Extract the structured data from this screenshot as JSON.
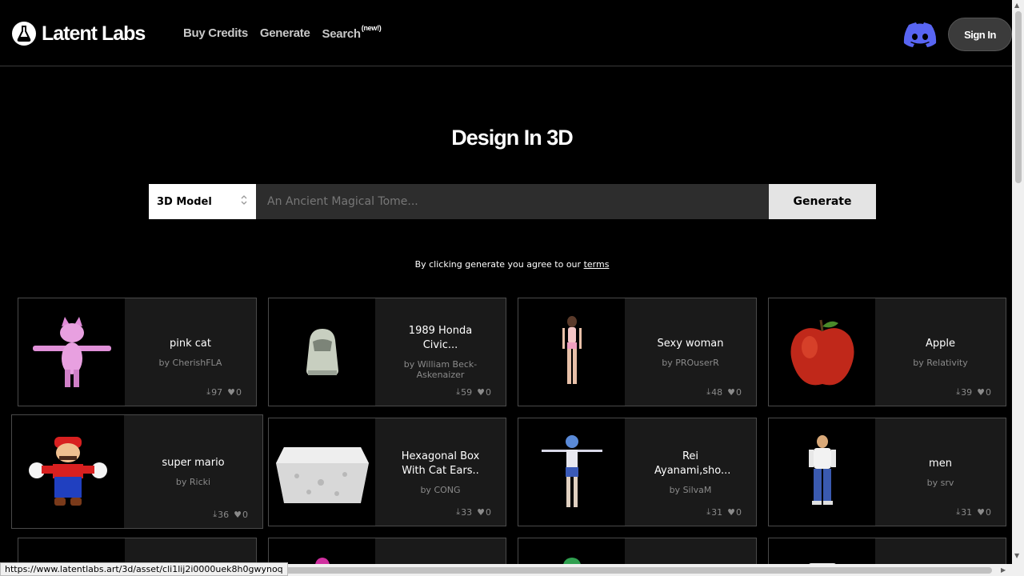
{
  "header": {
    "logo_text": "Latent Labs",
    "nav": [
      {
        "label": "Buy Credits"
      },
      {
        "label": "Generate"
      },
      {
        "label": "Search",
        "badge": "(new!)"
      }
    ],
    "signin_label": "Sign In",
    "discord_icon": "discord-icon",
    "discord_color": "#5865F2"
  },
  "hero": {
    "title": "Design In 3D",
    "select_value": "3D Model",
    "prompt_placeholder": "An Ancient Magical Tome...",
    "generate_label": "Generate",
    "terms_text": "By clicking generate you agree to our ",
    "terms_link": "terms"
  },
  "cards": [
    {
      "name": "pink cat",
      "author": "by CherishFLA",
      "downloads": "97",
      "likes": "0",
      "thumb": "pink-cat"
    },
    {
      "name": "1989 Honda Civic...",
      "author": "by William Beck-Askenaizer",
      "downloads": "59",
      "likes": "0",
      "thumb": "car"
    },
    {
      "name": "Sexy woman",
      "author": "by PROuserR",
      "downloads": "48",
      "likes": "0",
      "thumb": "woman"
    },
    {
      "name": "Apple",
      "author": "by Relativity",
      "downloads": "39",
      "likes": "0",
      "thumb": "apple"
    },
    {
      "name": "super mario",
      "author": "by Ricki",
      "downloads": "36",
      "likes": "0",
      "thumb": "mario"
    },
    {
      "name": "Hexagonal Box With Cat Ears..",
      "author": "by CONG",
      "downloads": "33",
      "likes": "0",
      "thumb": "box"
    },
    {
      "name": "Rei Ayanami,sho...",
      "author": "by SilvaM",
      "downloads": "31",
      "likes": "0",
      "thumb": "rei"
    },
    {
      "name": "men",
      "author": "by srv",
      "downloads": "31",
      "likes": "0",
      "thumb": "man"
    }
  ],
  "status_url": "https://www.latentlabs.art/3d/asset/cli1lij2i0000uek8h0gwynoq"
}
